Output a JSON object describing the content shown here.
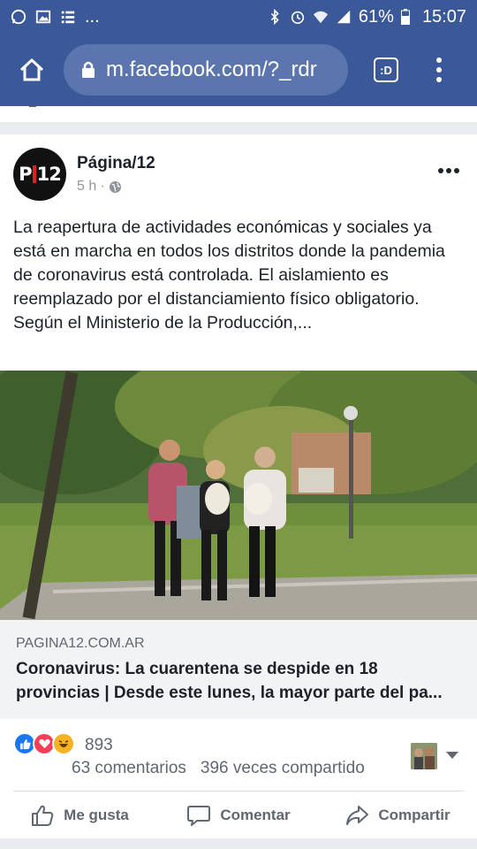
{
  "status_bar": {
    "left_icons": [
      "whatsapp-icon",
      "gallery-icon",
      "list-icon"
    ],
    "overflow": "...",
    "battery_percent": "61%",
    "time": "15:07"
  },
  "browser": {
    "url": "m.facebook.com/?_rdr",
    "tab_label": ":D"
  },
  "post": {
    "page_name": "Página/12",
    "avatar_text_left": "P",
    "avatar_text_right": "12",
    "time": "5 h",
    "separator": "·",
    "text": "La reapertura de actividades económicas y sociales ya está en marcha en todos los distritos donde la pandemia de coronavirus está controlada. El aislamiento es reemplazado por el distanciamiento físico obligatorio. Según el Ministerio de la Producción,...",
    "link": {
      "domain": "PAGINA12.COM.AR",
      "title": "Coronavirus: La cuarentena se despide en 18 provincias | Desde este lunes, la mayor parte del pa..."
    },
    "reactions": {
      "count": "893",
      "comments": "63 comentarios",
      "shares": "396 veces compartido"
    },
    "actions": {
      "like": "Me gusta",
      "comment": "Comentar",
      "share": "Compartir"
    }
  },
  "colors": {
    "brand": "#3b5998",
    "like_blue": "#1877f2",
    "love_red": "#f33e58",
    "haha_yellow": "#f7b125"
  }
}
